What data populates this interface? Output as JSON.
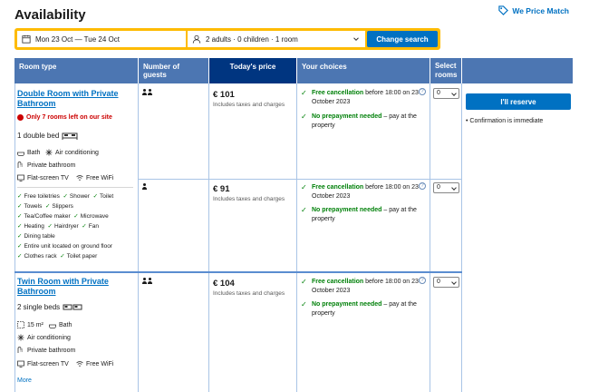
{
  "header": {
    "title": "Availability",
    "price_match": "We Price Match"
  },
  "search": {
    "dates": "Mon 23 Oct  —  Tue 24 Oct",
    "guests": "2 adults · 0 children · 1 room",
    "button": "Change search"
  },
  "table": {
    "headers": {
      "room_type": "Room type",
      "guests": "Number of guests",
      "price": "Today's price",
      "choices": "Your choices",
      "select": "Select rooms"
    }
  },
  "rooms": [
    {
      "name": "Double Room with Private Bathroom",
      "warning": "Only 7 rooms left on our site",
      "bed": "1 double bed",
      "facilities": [
        "Bath",
        "Air conditioning",
        "Private bathroom",
        "Flat-screen TV",
        "Free WiFi"
      ],
      "amenities": [
        "Free toiletries",
        "Shower",
        "Toilet",
        "Towels",
        "Slippers",
        "Tea/Coffee maker",
        "Microwave",
        "Heating",
        "Hairdryer",
        "Fan",
        "Dining table",
        "Entire unit located on ground floor",
        "Clothes rack",
        "Toilet paper"
      ],
      "options": [
        {
          "price": "€ 101",
          "price_note": "Includes taxes and charges",
          "cancel_bold": "Free cancellation",
          "cancel_rest": " before 18:00 on 23 October 2023",
          "prepay_bold": "No prepayment needed",
          "prepay_rest": " – pay at the property",
          "select_value": "0"
        },
        {
          "price": "€ 91",
          "price_note": "Includes taxes and charges",
          "cancel_bold": "Free cancellation",
          "cancel_rest": " before 18:00 on 23 October 2023",
          "prepay_bold": "No prepayment needed",
          "prepay_rest": " – pay at the property",
          "select_value": "0"
        }
      ]
    },
    {
      "name": "Twin Room with Private Bathroom",
      "bed": "2 single beds",
      "facilities": [
        "15 m²",
        "Bath",
        "Air conditioning",
        "Private bathroom",
        "Flat-screen TV",
        "Free WiFi"
      ],
      "more": "More",
      "options": [
        {
          "price": "€ 104",
          "price_note": "Includes taxes and charges",
          "cancel_bold": "Free cancellation",
          "cancel_rest": " before 18:00 on 23 October 2023",
          "prepay_bold": "No prepayment needed",
          "prepay_rest": " – pay at the property",
          "select_value": "0"
        }
      ]
    }
  ],
  "reserve": {
    "button": "I'll reserve",
    "note": "Confirmation is immediate"
  },
  "colors": {
    "brand_blue": "#0071c2",
    "header_blue": "#4c76b2",
    "dark_blue": "#003580",
    "search_yellow": "#febb02",
    "green": "#008009",
    "warning_red": "#cc0000"
  }
}
